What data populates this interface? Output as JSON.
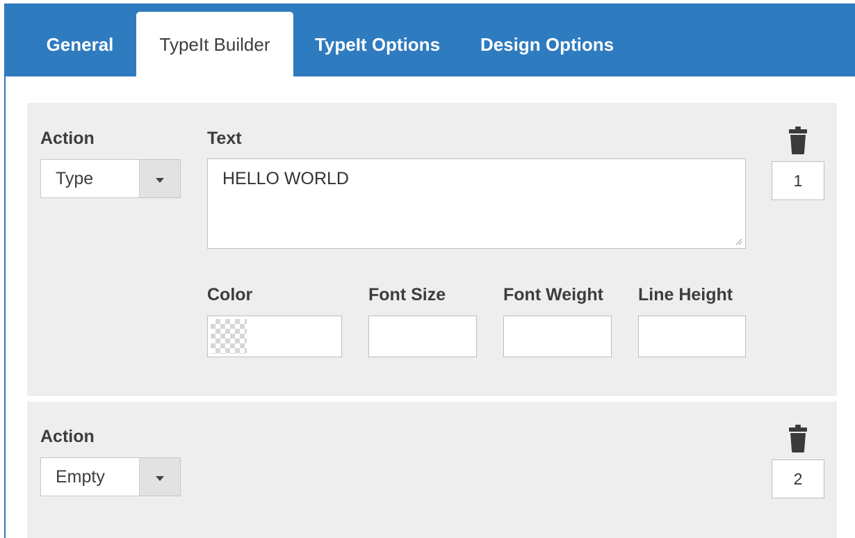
{
  "tabs": [
    {
      "label": "General",
      "active": false
    },
    {
      "label": "TypeIt Builder",
      "active": true
    },
    {
      "label": "TypeIt Options",
      "active": false
    },
    {
      "label": "Design Options",
      "active": false
    }
  ],
  "colors": {
    "tabbar": "#2f7bbf",
    "panel": "#eeeeee",
    "text": "#3d3d3d"
  },
  "rows": [
    {
      "action_label": "Action",
      "action_value": "Type",
      "text_label": "Text",
      "text_value": "HELLO WORLD",
      "color_label": "Color",
      "font_size_label": "Font Size",
      "font_weight_label": "Font Weight",
      "line_height_label": "Line Height",
      "order": "1",
      "delete_icon": "trash-icon"
    },
    {
      "action_label": "Action",
      "action_value": "Empty",
      "order": "2",
      "delete_icon": "trash-icon"
    }
  ]
}
